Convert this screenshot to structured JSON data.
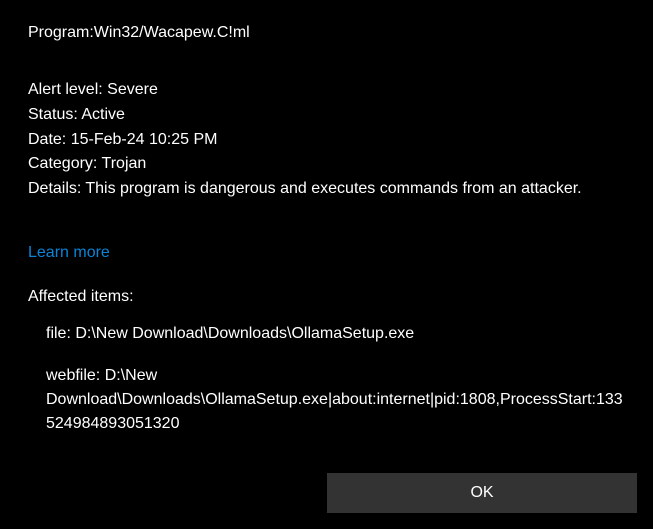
{
  "threat_name": "Program:Win32/Wacapew.C!ml",
  "details": {
    "alert_level_label": "Alert level:",
    "alert_level_value": "Severe",
    "status_label": "Status:",
    "status_value": "Active",
    "date_label": "Date:",
    "date_value": "15-Feb-24 10:25 PM",
    "category_label": "Category:",
    "category_value": "Trojan",
    "details_label": "Details:",
    "details_value": "This program is dangerous and executes commands from an attacker."
  },
  "learn_more_label": "Learn more",
  "affected_items": {
    "header": "Affected items:",
    "items": [
      "file: D:\\New Download\\Downloads\\OllamaSetup.exe",
      "webfile: D:\\New Download\\Downloads\\OllamaSetup.exe|about:internet|pid:1808,ProcessStart:133524984893051320"
    ]
  },
  "ok_button_label": "OK"
}
